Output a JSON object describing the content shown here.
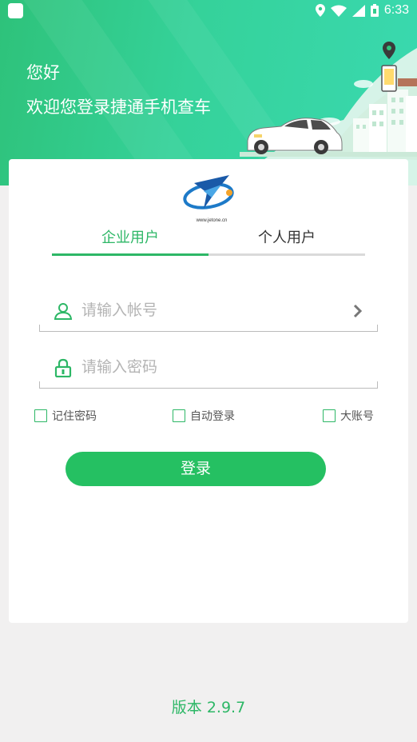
{
  "status_bar": {
    "time": "6:33",
    "icons": [
      "notification-icon",
      "location-icon",
      "wifi-icon",
      "signal-icon",
      "battery-icon"
    ]
  },
  "header": {
    "greeting": "您好",
    "welcome": "欢迎您登录捷通手机查车"
  },
  "logo": {
    "url_text": "www.jetone.cn"
  },
  "tabs": [
    {
      "label": "企业用户",
      "active": true
    },
    {
      "label": "个人用户",
      "active": false
    }
  ],
  "form": {
    "account": {
      "placeholder": "请输入帐号",
      "value": ""
    },
    "password": {
      "placeholder": "请输入密码",
      "value": ""
    }
  },
  "options": {
    "remember_password": {
      "label": "记住密码",
      "checked": false
    },
    "auto_login": {
      "label": "自动登录",
      "checked": false
    },
    "big_account": {
      "label": "大账号",
      "checked": false
    }
  },
  "login_button": "登录",
  "version": "版本 2.9.7",
  "colors": {
    "accent": "#2db766",
    "button": "#25c062",
    "banner_start": "#2ec27a",
    "banner_end": "#3ad9b0",
    "page_bg": "#f1f0f0"
  }
}
